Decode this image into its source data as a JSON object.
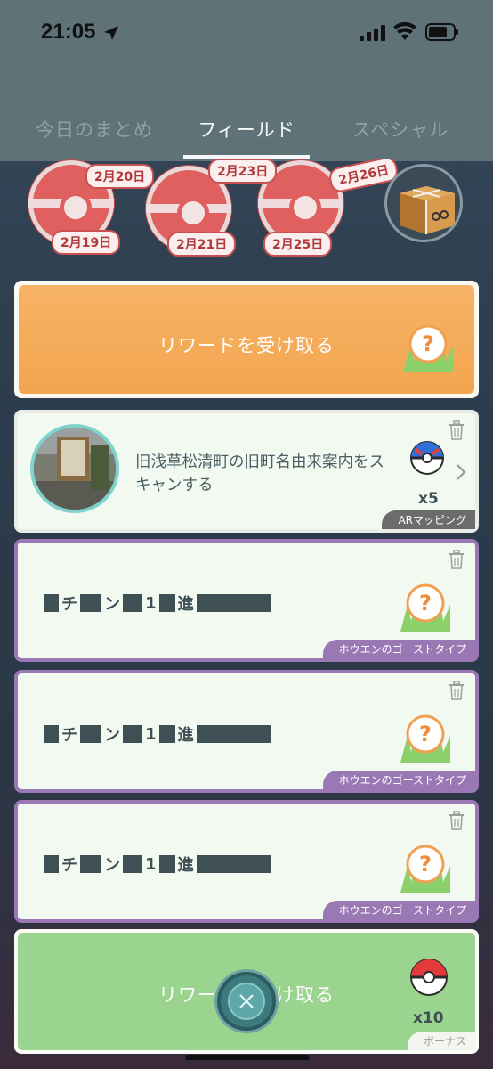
{
  "status_bar": {
    "time": "21:05"
  },
  "tabs": [
    {
      "label": "今日のまとめ"
    },
    {
      "label": "フィールド"
    },
    {
      "label": "スペシャル"
    }
  ],
  "active_tab": "フィールド",
  "stamps": {
    "dates": [
      "2月19日",
      "2月20日",
      "2月21日",
      "2月23日",
      "2月25日",
      "2月26日"
    ]
  },
  "reward_card": {
    "label": "リワードを受け取る"
  },
  "quests": [
    {
      "text": "旧浅草松清町の旧町名由来案内をスキャンする",
      "reward_count": "x5",
      "tag": "ARマッピング"
    },
    {
      "masked": [
        "チ",
        "ン",
        "1",
        "進"
      ],
      "tag": "ホウエンのゴーストタイプ"
    },
    {
      "masked": [
        "チ",
        "ン",
        "1",
        "進"
      ],
      "tag": "ホウエンのゴーストタイプ"
    },
    {
      "masked": [
        "チ",
        "ン",
        "1",
        "進"
      ],
      "tag": "ホウエンのゴーストタイプ"
    }
  ],
  "bonus_card": {
    "label": "リワードを受け取る",
    "reward_count": "x10",
    "tag": "ボーナス"
  },
  "colors": {
    "header": "#5e7278",
    "reward_orange": "#f3a54e",
    "ghost_tag_purple": "#9a78b4",
    "bonus_green": "#9bd48e"
  }
}
